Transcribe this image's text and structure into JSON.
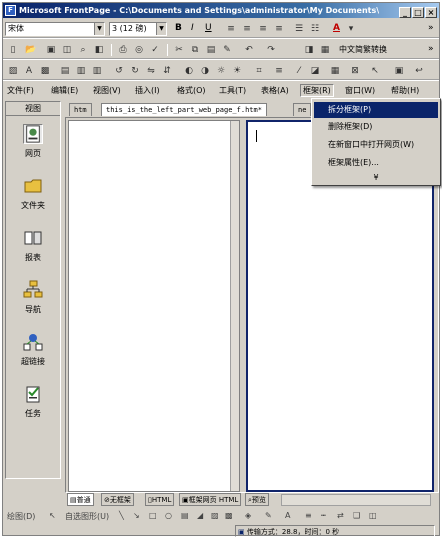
{
  "window": {
    "title": "Microsoft FrontPage - C:\\Documents and Settings\\administrator\\My Documents\\My Webs\\...",
    "controls": {
      "minimize": "_",
      "maximize": "□",
      "close": "×"
    }
  },
  "toolbar_format": {
    "font_name": "宋体",
    "font_size": "3 (12 磅)",
    "bold": "B",
    "italic": "I",
    "underline": "U",
    "font_color_label": "A",
    "overflow": "»"
  },
  "toolbar_standard": {
    "convert_label": "中文简繁转换",
    "overflow": "»"
  },
  "menubar": {
    "items": [
      "文件(F)",
      "编辑(E)",
      "视图(V)",
      "插入(I)",
      "格式(O)",
      "工具(T)",
      "表格(A)",
      "框架(R)",
      "窗口(W)",
      "帮助(H)"
    ]
  },
  "views": {
    "header": "视图",
    "items": [
      {
        "label": "网页",
        "icon": "page-view-icon"
      },
      {
        "label": "文件夹",
        "icon": "folder-view-icon"
      },
      {
        "label": "报表",
        "icon": "reports-view-icon"
      },
      {
        "label": "导航",
        "icon": "navigation-view-icon"
      },
      {
        "label": "超链接",
        "icon": "hyperlinks-view-icon"
      },
      {
        "label": "任务",
        "icon": "tasks-view-icon"
      }
    ]
  },
  "doc_tabs": {
    "tab1": "htm",
    "tab2": "this_is_the_left_part_web_page_f.htm*",
    "tab3": "ne"
  },
  "frames_menu": {
    "items": [
      "拆分框架(P)",
      "删除框架(D)",
      "在新窗口中打开网页(W)",
      "框架属性(E)..."
    ],
    "more": "¥"
  },
  "view_tabs": {
    "normal": "普通",
    "no_frames": "无框架",
    "html": "HTML",
    "frames_page_html": "框架网页 HTML",
    "preview": "预览"
  },
  "drawing_toolbar": {
    "draw": "绘图(D)",
    "autoshapes": "自选图形(U)"
  },
  "status": {
    "speed": "传输方式：28.8，时间：0 秒"
  }
}
